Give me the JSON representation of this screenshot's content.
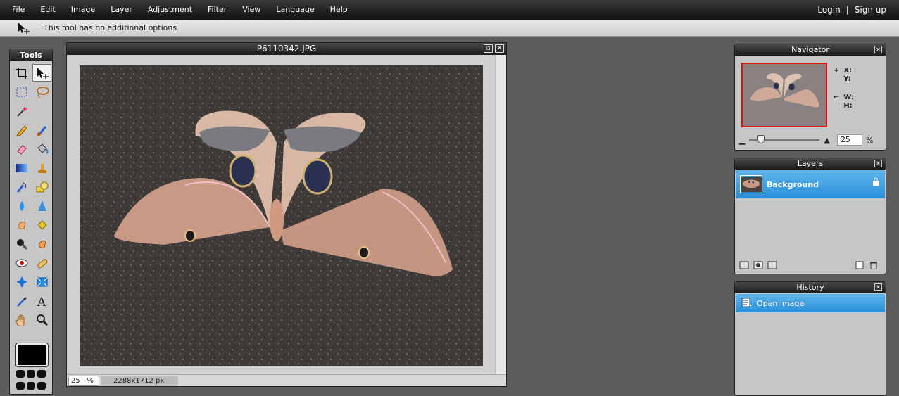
{
  "menubar": {
    "items": [
      "File",
      "Edit",
      "Image",
      "Layer",
      "Adjustment",
      "Filter",
      "View",
      "Language",
      "Help"
    ],
    "login": "Login",
    "separator": "|",
    "signup": "Sign up"
  },
  "options_bar": {
    "icon": "move-tool-icon",
    "text": "This tool has no additional options"
  },
  "tools": {
    "title": "Tools",
    "items": [
      "crop-icon",
      "move-icon",
      "marquee-icon",
      "lasso-icon",
      "magic-wand-icon",
      "",
      "pencil-icon",
      "brush-icon",
      "eraser-icon",
      "bucket-icon",
      "gradient-icon",
      "clone-stamp-icon",
      "color-replace-icon",
      "shape-icon",
      "drop-icon",
      "sharpen-icon",
      "smudge-icon",
      "sponge-icon",
      "burn-icon",
      "dodge-icon",
      "red-eye-icon",
      "spot-heal-icon",
      "bloat-icon",
      "pinch-icon",
      "color-picker-icon",
      "type-icon",
      "hand-icon",
      "zoom-icon"
    ],
    "foreground_color": "#000000"
  },
  "image_window": {
    "title": "P6110342.JPG",
    "zoom": "25",
    "zoom_unit": "%",
    "dimensions": "2288x1712 px"
  },
  "navigator": {
    "title": "Navigator",
    "x_label": "X:",
    "y_label": "Y:",
    "w_label": "W:",
    "h_label": "H:",
    "zoom": "25",
    "zoom_unit": "%"
  },
  "layers": {
    "title": "Layers",
    "items": [
      {
        "name": "Background",
        "locked": true
      }
    ]
  },
  "history": {
    "title": "History",
    "items": [
      "Open image"
    ]
  },
  "colors": {
    "selection_blue": "#2a8fd8",
    "navigator_frame": "#dd1111"
  }
}
